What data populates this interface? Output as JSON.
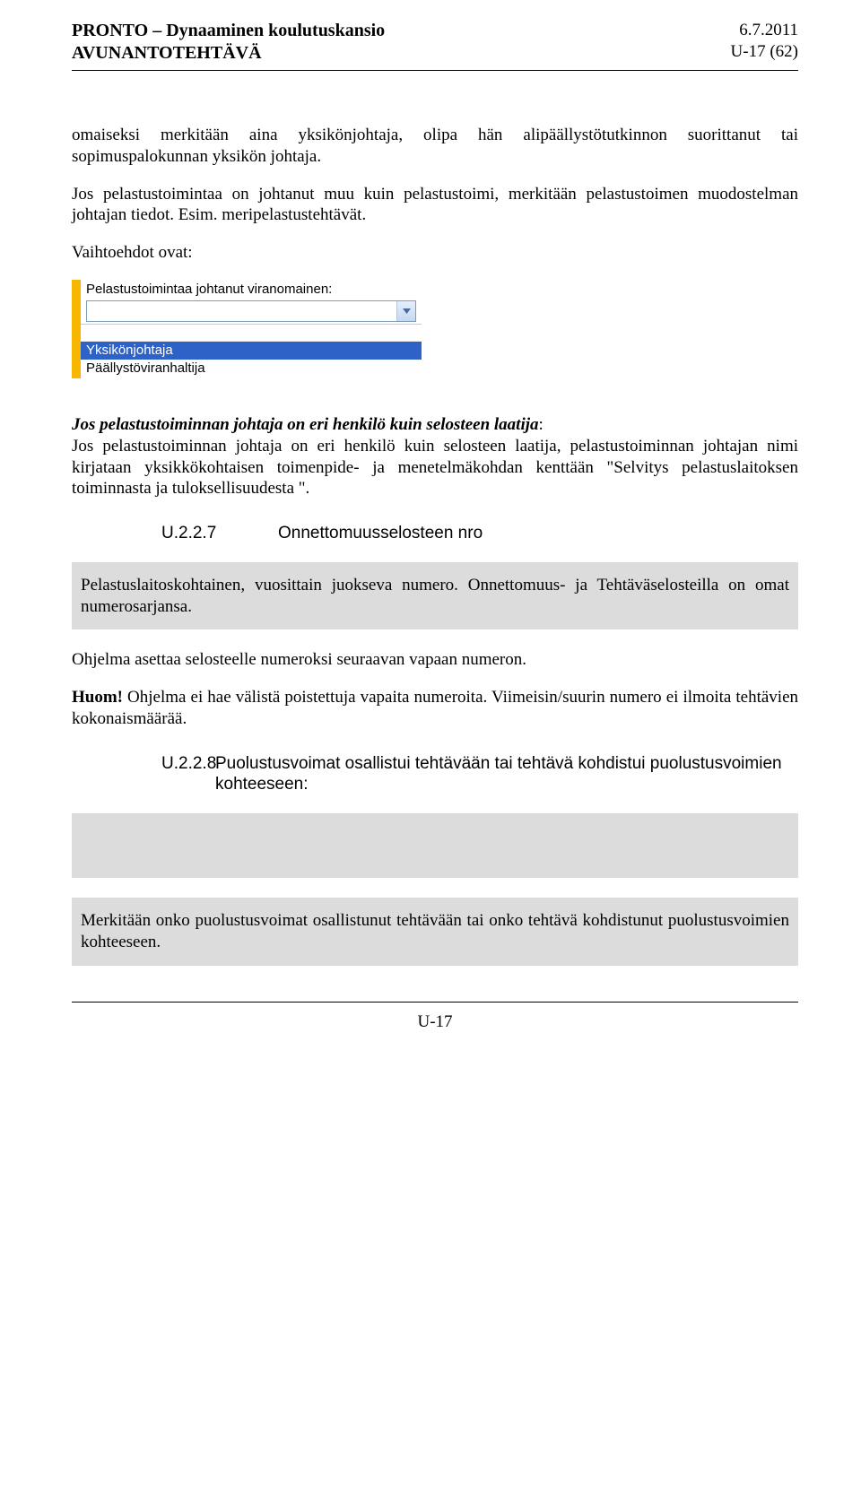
{
  "header": {
    "title1": "PRONTO – Dynaaminen koulutuskansio",
    "title2": "AVUNANTOTEHTÄVÄ",
    "date": "6.7.2011",
    "page_of": "U-17 (62)"
  },
  "body": {
    "p1": "omaiseksi merkitään aina yksikönjohtaja, olipa hän alipäällystötutkinnon suorittanut tai sopimuspalokunnan yksikön johtaja.",
    "p2": "Jos pelastustoimintaa on johtanut muu kuin pelastustoimi, merkitään pelastustoimen muodostelman johtajan tiedot. Esim. meripelastustehtävät.",
    "p3": "Vaihtoehdot ovat:",
    "dropdown": {
      "label": "Pelastustoimintaa johtanut viranomainen:",
      "options": [
        "",
        "Yksikönjohtaja",
        "Päällystöviranhaltija"
      ],
      "selected": "Yksikönjohtaja"
    },
    "p4_strong": "Jos pelastustoiminnan johtaja on eri henkilö kuin selosteen laatija",
    "p4_rest": "Jos pelastustoiminnan johtaja on eri henkilö kuin selosteen laatija, pelastustoiminnan johtajan nimi kirjataan yksikkökohtaisen toimenpide- ja menetelmäkohdan kenttään \"Selvitys pelastuslaitoksen toiminnasta ja tuloksellisuudesta \".",
    "sec227_num": "U.2.2.7",
    "sec227_title": "Onnettomuusselosteen nro",
    "gray1": "Pelastuslaitoskohtainen, vuosittain juokseva numero. Onnettomuus- ja Tehtäväselosteilla on omat numerosarjansa.",
    "p5": "Ohjelma asettaa selosteelle numeroksi seuraavan vapaan numeron.",
    "p6a": "Huom!",
    "p6b": " Ohjelma ei hae välistä poistettuja vapaita numeroita. Viimeisin/suurin numero ei ilmoita tehtävien kokonaismäärää.",
    "sec228_num": "U.2.2.8",
    "sec228_title": "Puolustusvoimat osallistui tehtävään tai tehtävä kohdistui puolustusvoimien kohteeseen:",
    "gray3": "Merkitään onko puolustusvoimat osallistunut tehtävään tai onko tehtävä kohdistunut puolustusvoimien kohteeseen."
  },
  "footer": {
    "page": "U-17"
  }
}
